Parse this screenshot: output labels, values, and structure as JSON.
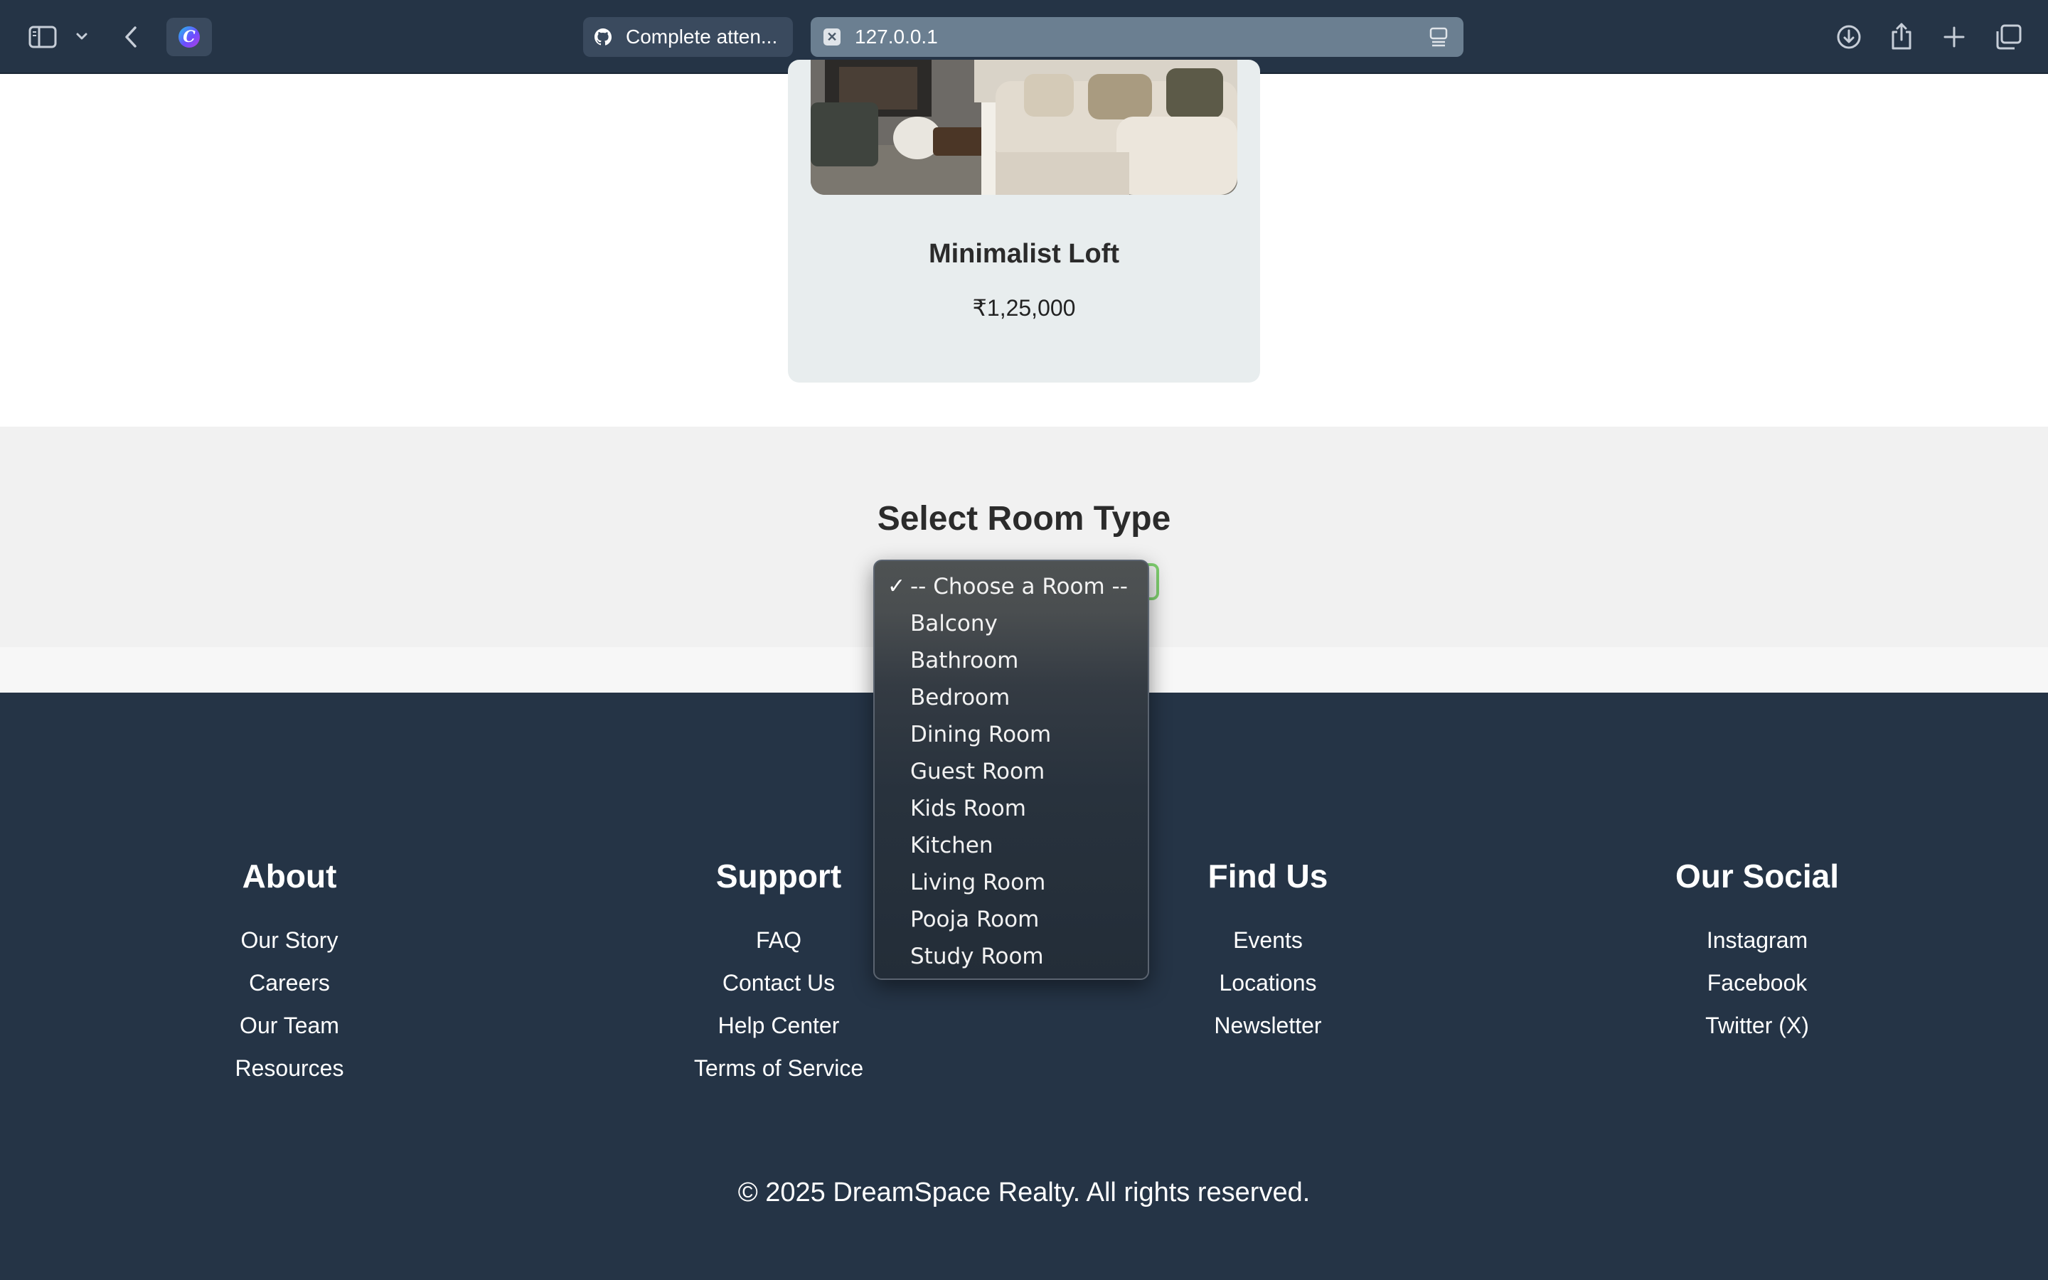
{
  "browser": {
    "tabs": [
      {
        "label": "Complete atten...",
        "favicon": "github-icon",
        "active": false
      },
      {
        "label": "127.0.0.1",
        "favicon": "close-icon",
        "active": true
      }
    ],
    "extension_letter": "C"
  },
  "listing": {
    "title": "Minimalist Loft",
    "price": "₹1,25,000"
  },
  "room_select": {
    "heading": "Select Room Type",
    "selected": "-- Choose a Room --",
    "options": [
      "-- Choose a Room --",
      "Balcony",
      "Bathroom",
      "Bedroom",
      "Dining Room",
      "Guest Room",
      "Kids Room",
      "Kitchen",
      "Living Room",
      "Pooja Room",
      "Study Room"
    ]
  },
  "footer": {
    "columns": [
      {
        "heading": "About",
        "links": [
          "Our Story",
          "Careers",
          "Our Team",
          "Resources"
        ]
      },
      {
        "heading": "Support",
        "links": [
          "FAQ",
          "Contact Us",
          "Help Center",
          "Terms of Service"
        ]
      },
      {
        "heading": "Find Us",
        "links": [
          "Events",
          "Locations",
          "Newsletter"
        ]
      },
      {
        "heading": "Our Social",
        "links": [
          "Instagram",
          "Facebook",
          "Twitter (X)"
        ]
      }
    ],
    "copyright": "© 2025 DreamSpace Realty. All rights reserved."
  },
  "colors": {
    "chrome_bg": "#253446",
    "card_bg": "#e8edee",
    "section_bg": "#f1f1f1",
    "footer_bg": "#253446",
    "select_focus": "#7fcf6f"
  }
}
